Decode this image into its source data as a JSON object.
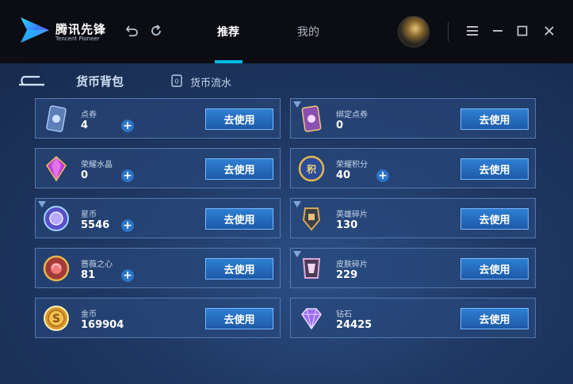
{
  "app": {
    "brand_cn": "腾讯先锋",
    "brand_en": "Tencent Pioneer"
  },
  "nav": {
    "tabs": [
      {
        "label": "推荐",
        "active": true
      },
      {
        "label": "我的",
        "active": false
      }
    ]
  },
  "page": {
    "section_title": "货币背包",
    "flow_link": "货币流水"
  },
  "currencies": [
    {
      "name": "点券",
      "value": "4",
      "action": "去使用",
      "icon": "voucher-card-icon",
      "has_plus": true
    },
    {
      "name": "绑定点券",
      "value": "0",
      "action": "去使用",
      "icon": "bound-voucher-card-icon",
      "has_plus": false
    },
    {
      "name": "荣耀水晶",
      "value": "0",
      "action": "去使用",
      "icon": "glory-crystal-icon",
      "has_plus": true
    },
    {
      "name": "荣耀积分",
      "value": "40",
      "action": "去使用",
      "icon": "glory-points-icon",
      "has_plus": true
    },
    {
      "name": "星币",
      "value": "5546",
      "action": "去使用",
      "icon": "star-coin-icon",
      "has_plus": true
    },
    {
      "name": "英雄碎片",
      "value": "130",
      "action": "去使用",
      "icon": "hero-fragment-icon",
      "has_plus": false
    },
    {
      "name": "蔷薇之心",
      "value": "81",
      "action": "去使用",
      "icon": "rose-heart-icon",
      "has_plus": true
    },
    {
      "name": "皮肤碎片",
      "value": "229",
      "action": "去使用",
      "icon": "skin-fragment-icon",
      "has_plus": false
    },
    {
      "name": "金币",
      "value": "169904",
      "action": "去使用",
      "icon": "gold-coin-icon",
      "has_plus": false
    },
    {
      "name": "钻石",
      "value": "24425",
      "action": "去使用",
      "icon": "diamond-icon",
      "has_plus": false
    }
  ],
  "colors": {
    "accent": "#00b7e3",
    "button": "#2f7fd3",
    "panel_bg": "#1f3863"
  }
}
